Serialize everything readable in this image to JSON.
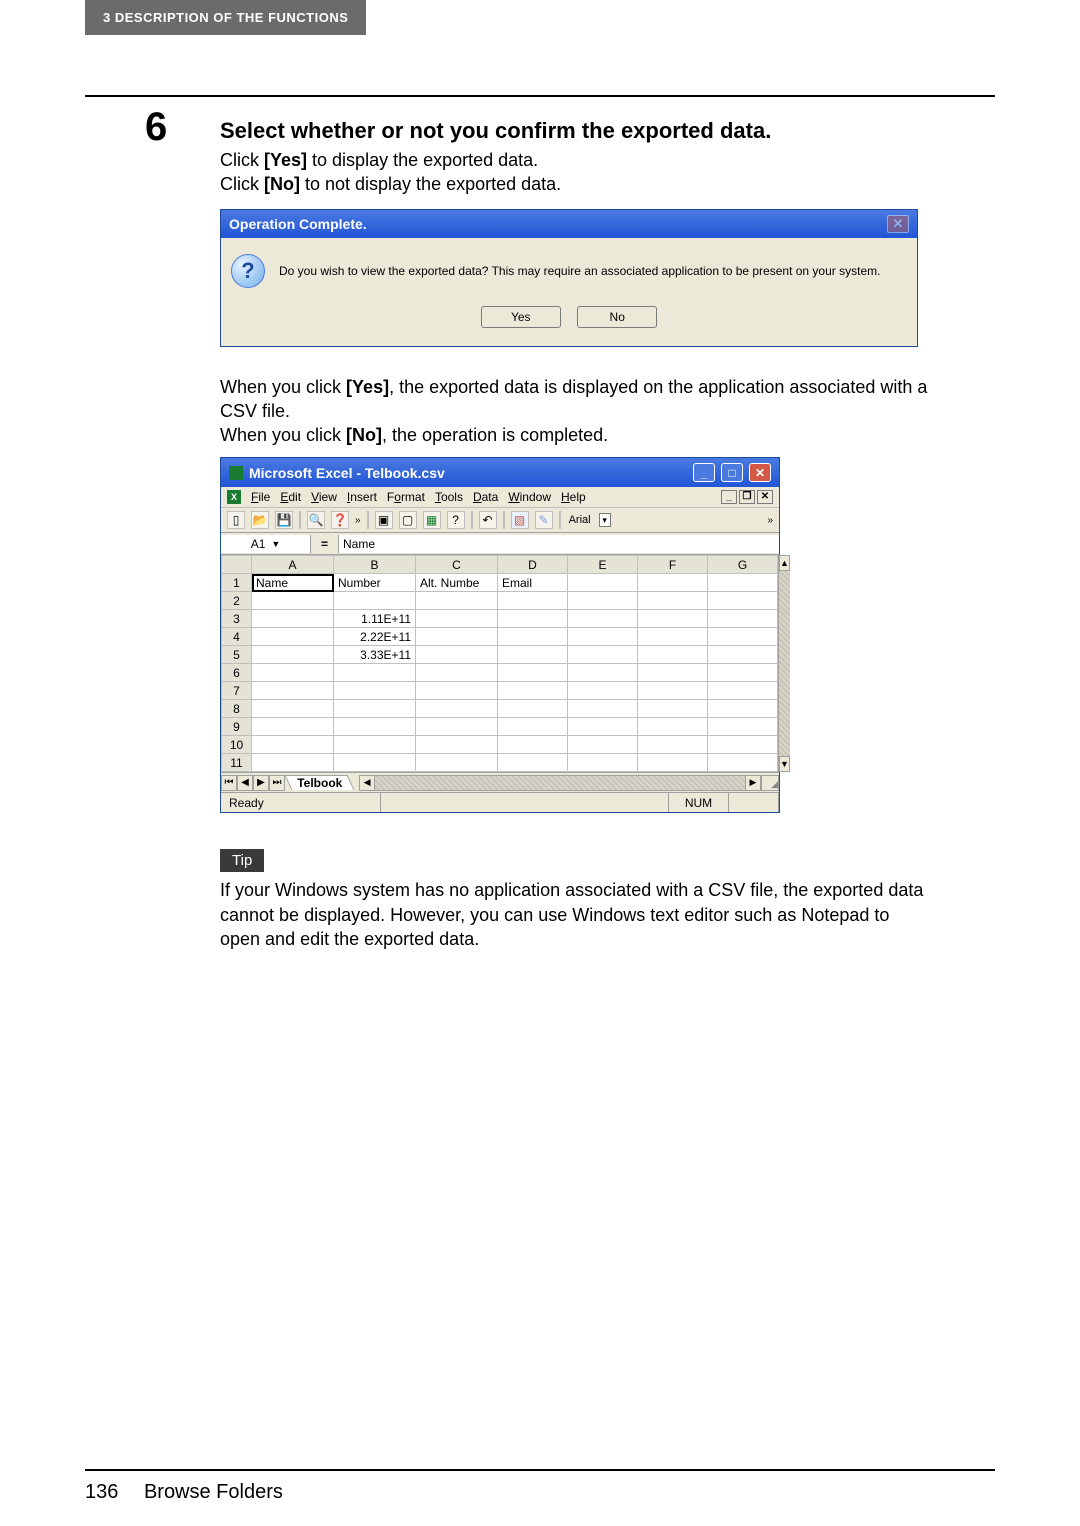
{
  "header": {
    "chapter": "3  DESCRIPTION OF THE FUNCTIONS"
  },
  "step": {
    "number": "6",
    "title": "Select whether or not you confirm the exported data.",
    "line1_a": "Click ",
    "line1_b": "[Yes]",
    "line1_c": " to display the exported data.",
    "line2_a": "Click ",
    "line2_b": "[No]",
    "line2_c": " to not display the exported data."
  },
  "dialog1": {
    "title": "Operation Complete.",
    "message": "Do you wish to view the exported data? This may require an associated application to be present on your system.",
    "yes": "Yes",
    "no": "No"
  },
  "para": {
    "p1_a": "When you click ",
    "p1_b": "[Yes]",
    "p1_c": ", the exported data is displayed on the application associated with a CSV file.",
    "p2_a": "When you click ",
    "p2_b": "[No]",
    "p2_c": ", the operation is completed."
  },
  "excel": {
    "title": "Microsoft Excel - Telbook.csv",
    "menu": {
      "file": "File",
      "edit": "Edit",
      "view": "View",
      "insert": "Insert",
      "format": "Format",
      "tools": "Tools",
      "data": "Data",
      "window": "Window",
      "help": "Help"
    },
    "toolbar": {
      "font": "Arial"
    },
    "namebox": "A1",
    "formula": "Name",
    "columns": [
      "A",
      "B",
      "C",
      "D",
      "E",
      "F",
      "G"
    ],
    "headers_row": {
      "a": "Name",
      "b": "Number",
      "c": "Alt. Numbe",
      "d": "Email"
    },
    "rows": [
      {
        "n": "1"
      },
      {
        "n": "2"
      },
      {
        "n": "3",
        "b": "1.11E+11"
      },
      {
        "n": "4",
        "b": "2.22E+11"
      },
      {
        "n": "5",
        "b": "3.33E+11"
      },
      {
        "n": "6"
      },
      {
        "n": "7"
      },
      {
        "n": "8"
      },
      {
        "n": "9"
      },
      {
        "n": "10"
      },
      {
        "n": "11"
      }
    ],
    "sheet_tab": "Telbook",
    "status_ready": "Ready",
    "status_num": "NUM"
  },
  "tip": {
    "label": "Tip",
    "text": "If your Windows system has no application associated with a CSV file, the exported data cannot be displayed. However, you can use Windows text editor such as Notepad to open and edit the exported data."
  },
  "footer": {
    "page": "136",
    "title": "Browse Folders"
  }
}
